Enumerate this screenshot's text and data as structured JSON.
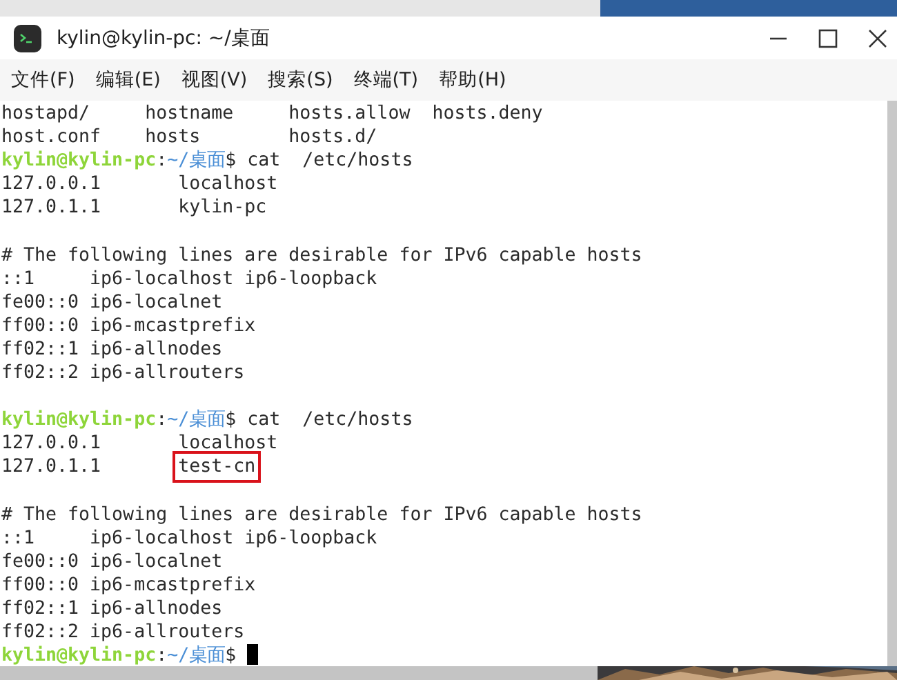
{
  "window": {
    "title": "kylin@kylin-pc: ~/桌面"
  },
  "menu": [
    {
      "label": "文件(F)"
    },
    {
      "label": "编辑(E)"
    },
    {
      "label": "视图(V)"
    },
    {
      "label": "搜索(S)"
    },
    {
      "label": "终端(T)"
    },
    {
      "label": "帮助(H)"
    }
  ],
  "terminal": {
    "lines": [
      {
        "kind": "output",
        "parts": [
          {
            "text": "hostapd/     hostname     hosts.allow  hosts.deny",
            "boxed": false
          }
        ]
      },
      {
        "kind": "output",
        "parts": [
          {
            "text": "host.conf    hosts        hosts.d/",
            "boxed": false
          }
        ]
      },
      {
        "kind": "prompt",
        "user": "kylin@kylin-pc",
        "separator": ":",
        "path": "~/桌面",
        "command": "$ cat  /etc/hosts",
        "cursor": false
      },
      {
        "kind": "output",
        "parts": [
          {
            "text": "127.0.0.1       localhost",
            "boxed": false
          }
        ]
      },
      {
        "kind": "output",
        "parts": [
          {
            "text": "127.0.1.1       kylin-pc",
            "boxed": false
          }
        ]
      },
      {
        "kind": "blank"
      },
      {
        "kind": "output",
        "parts": [
          {
            "text": "# The following lines are desirable for IPv6 capable hosts",
            "boxed": false
          }
        ]
      },
      {
        "kind": "output",
        "parts": [
          {
            "text": "::1     ip6-localhost ip6-loopback",
            "boxed": false
          }
        ]
      },
      {
        "kind": "output",
        "parts": [
          {
            "text": "fe00::0 ip6-localnet",
            "boxed": false
          }
        ]
      },
      {
        "kind": "output",
        "parts": [
          {
            "text": "ff00::0 ip6-mcastprefix",
            "boxed": false
          }
        ]
      },
      {
        "kind": "output",
        "parts": [
          {
            "text": "ff02::1 ip6-allnodes",
            "boxed": false
          }
        ]
      },
      {
        "kind": "output",
        "parts": [
          {
            "text": "ff02::2 ip6-allrouters",
            "boxed": false
          }
        ]
      },
      {
        "kind": "blank"
      },
      {
        "kind": "prompt",
        "user": "kylin@kylin-pc",
        "separator": ":",
        "path": "~/桌面",
        "command": "$ cat  /etc/hosts",
        "cursor": false
      },
      {
        "kind": "output",
        "parts": [
          {
            "text": "127.0.0.1       localhost",
            "boxed": false
          }
        ]
      },
      {
        "kind": "output",
        "parts": [
          {
            "text": "127.0.1.1       ",
            "boxed": false
          },
          {
            "text": "test-cn",
            "boxed": true
          }
        ]
      },
      {
        "kind": "blank"
      },
      {
        "kind": "output",
        "parts": [
          {
            "text": "# The following lines are desirable for IPv6 capable hosts",
            "boxed": false
          }
        ]
      },
      {
        "kind": "output",
        "parts": [
          {
            "text": "::1     ip6-localhost ip6-loopback",
            "boxed": false
          }
        ]
      },
      {
        "kind": "output",
        "parts": [
          {
            "text": "fe00::0 ip6-localnet",
            "boxed": false
          }
        ]
      },
      {
        "kind": "output",
        "parts": [
          {
            "text": "ff00::0 ip6-mcastprefix",
            "boxed": false
          }
        ]
      },
      {
        "kind": "output",
        "parts": [
          {
            "text": "ff02::1 ip6-allnodes",
            "boxed": false
          }
        ]
      },
      {
        "kind": "output",
        "parts": [
          {
            "text": "ff02::2 ip6-allrouters",
            "boxed": false
          }
        ]
      },
      {
        "kind": "prompt",
        "user": "kylin@kylin-pc",
        "separator": ":",
        "path": "~/桌面",
        "command": "$ ",
        "cursor": true
      }
    ]
  }
}
